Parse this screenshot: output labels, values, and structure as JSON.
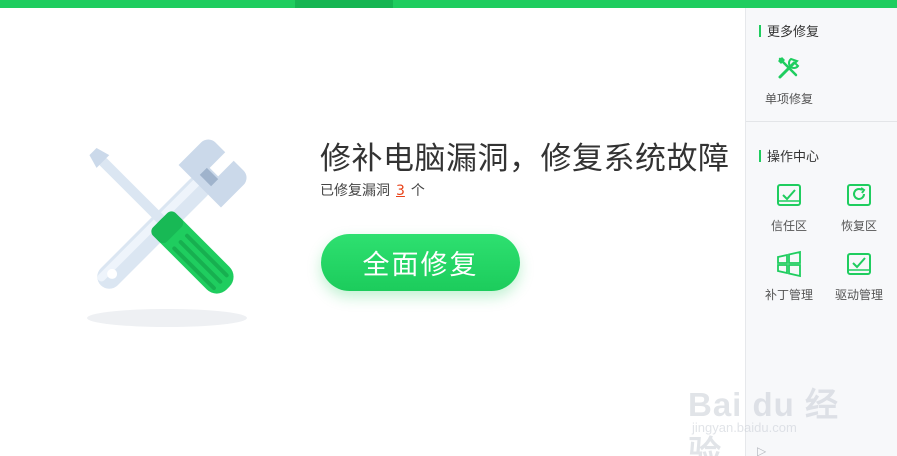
{
  "header": {
    "active_tab_color": "#16b552"
  },
  "main": {
    "headline": "修补电脑漏洞，修复系统故障",
    "status_prefix": "已修复漏洞",
    "fixed_count": "3",
    "status_suffix": "个",
    "repair_button_label": "全面修复",
    "illustration": "wrench-and-screwdriver-icon"
  },
  "sidebar": {
    "more_repair": {
      "title": "更多修复",
      "items": [
        {
          "label": "单项修复",
          "icon": "tools-icon"
        }
      ]
    },
    "operation_center": {
      "title": "操作中心",
      "items": [
        {
          "label": "信任区",
          "icon": "trust-zone-icon"
        },
        {
          "label": "恢复区",
          "icon": "restore-zone-icon"
        },
        {
          "label": "补丁管理",
          "icon": "windows-patch-icon"
        },
        {
          "label": "驱动管理",
          "icon": "driver-manage-icon"
        }
      ]
    }
  },
  "watermark": {
    "text": "Bai du 经验",
    "url": "jingyan.baidu.com"
  },
  "colors": {
    "accent": "#1fcd5f",
    "count_highlight": "#e8431a"
  }
}
